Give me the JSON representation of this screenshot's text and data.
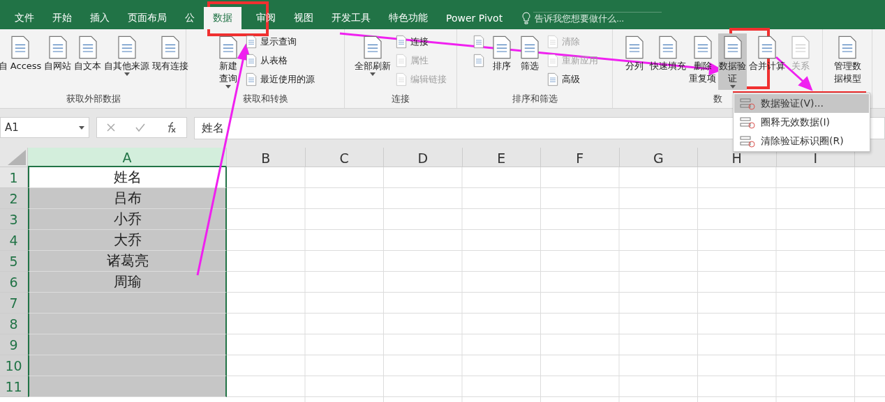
{
  "tabs": [
    {
      "label": "文件",
      "selected": false
    },
    {
      "label": "开始",
      "selected": false
    },
    {
      "label": "插入",
      "selected": false
    },
    {
      "label": "页面布局",
      "selected": false
    },
    {
      "label": "公",
      "selected": false
    },
    {
      "label": "数据",
      "selected": true
    },
    {
      "label": "审阅",
      "selected": false
    },
    {
      "label": "视图",
      "selected": false
    },
    {
      "label": "开发工具",
      "selected": false
    },
    {
      "label": "特色功能",
      "selected": false
    },
    {
      "label": "Power Pivot",
      "selected": false
    }
  ],
  "tell_me": {
    "placeholder": "告诉我您想要做什么..."
  },
  "ribbon_groups": [
    {
      "label": "获取外部数据",
      "items": [
        {
          "kind": "large",
          "lines": [
            "自 Access"
          ],
          "disabled": false,
          "dropdown": false
        },
        {
          "kind": "large",
          "lines": [
            "自网站"
          ],
          "disabled": false,
          "dropdown": false
        },
        {
          "kind": "large",
          "lines": [
            "自文本"
          ],
          "disabled": false,
          "dropdown": false
        },
        {
          "kind": "large",
          "lines": [
            "自其他来源"
          ],
          "disabled": false,
          "dropdown": true
        },
        {
          "kind": "large",
          "lines": [
            "现有连接"
          ],
          "disabled": false,
          "dropdown": false
        }
      ]
    },
    {
      "label": "获取和转换",
      "items": [
        {
          "kind": "large",
          "lines": [
            "新建",
            "查询"
          ],
          "disabled": false,
          "dropdown": true
        },
        {
          "kind": "stack",
          "entries": [
            {
              "label": "显示查询",
              "disabled": false
            },
            {
              "label": "从表格",
              "disabled": false
            },
            {
              "label": "最近使用的源",
              "disabled": false
            }
          ]
        }
      ]
    },
    {
      "label": "连接",
      "items": [
        {
          "kind": "large",
          "lines": [
            "全部刷新"
          ],
          "disabled": false,
          "dropdown": true
        },
        {
          "kind": "stack",
          "entries": [
            {
              "label": "连接",
              "disabled": false
            },
            {
              "label": "属性",
              "disabled": true
            },
            {
              "label": "编辑链接",
              "disabled": true
            }
          ]
        }
      ]
    },
    {
      "label": "排序和筛选",
      "items": [
        {
          "kind": "stack",
          "entries": [
            {
              "disabled": false
            },
            {
              "disabled": false
            }
          ]
        },
        {
          "kind": "large",
          "lines": [
            "排序"
          ],
          "disabled": false,
          "dropdown": false
        },
        {
          "kind": "large",
          "lines": [
            "筛选"
          ],
          "disabled": false,
          "dropdown": false
        },
        {
          "kind": "stack",
          "entries": [
            {
              "label": "清除",
              "disabled": true
            },
            {
              "label": "重新应用",
              "disabled": true
            },
            {
              "label": "高级",
              "disabled": false
            }
          ]
        }
      ]
    },
    {
      "label": "数",
      "items": [
        {
          "kind": "large",
          "lines": [
            "分列"
          ],
          "disabled": false,
          "dropdown": false
        },
        {
          "kind": "large",
          "lines": [
            "快速填充"
          ],
          "disabled": false,
          "dropdown": false
        },
        {
          "kind": "large",
          "lines": [
            "删除",
            "重复项"
          ],
          "disabled": false,
          "dropdown": false
        },
        {
          "kind": "large",
          "lines": [
            "数据验",
            "证"
          ],
          "disabled": false,
          "dropdown": true,
          "selected": true
        },
        {
          "kind": "large",
          "lines": [
            "合并计算"
          ],
          "disabled": false,
          "dropdown": false
        },
        {
          "kind": "large",
          "lines": [
            "关系"
          ],
          "disabled": true,
          "dropdown": false
        }
      ]
    },
    {
      "items": [
        {
          "kind": "large",
          "lines": [
            "管理数",
            "据模型"
          ],
          "disabled": false,
          "dropdown": false
        }
      ]
    }
  ],
  "name_box": "A1",
  "formula": "姓名",
  "columns": [
    {
      "label": "A",
      "selected": true
    },
    {
      "label": "B",
      "selected": false
    },
    {
      "label": "C",
      "selected": false
    },
    {
      "label": "D",
      "selected": false
    },
    {
      "label": "E",
      "selected": false
    },
    {
      "label": "F",
      "selected": false
    },
    {
      "label": "G",
      "selected": false
    },
    {
      "label": "H",
      "selected": false
    },
    {
      "label": "I",
      "selected": false
    }
  ],
  "rows": [
    {
      "number": "1",
      "value": "姓名",
      "selected": false
    },
    {
      "number": "2",
      "value": "吕布",
      "selected": true
    },
    {
      "number": "3",
      "value": "小乔",
      "selected": true
    },
    {
      "number": "4",
      "value": "大乔",
      "selected": true
    },
    {
      "number": "5",
      "value": "诸葛亮",
      "selected": true
    },
    {
      "number": "6",
      "value": "周瑜",
      "selected": true
    },
    {
      "number": "7",
      "selected": true
    },
    {
      "number": "8",
      "selected": true
    },
    {
      "number": "9",
      "selected": true
    },
    {
      "number": "10",
      "selected": true
    },
    {
      "number": "11",
      "selected": true
    }
  ],
  "dropdown_menu": [
    {
      "label": "数据验证(V)...",
      "selected": true
    },
    {
      "label": "圈释无效数据(I)",
      "selected": false
    },
    {
      "label": "清除验证标识圈(R)",
      "selected": false
    }
  ]
}
